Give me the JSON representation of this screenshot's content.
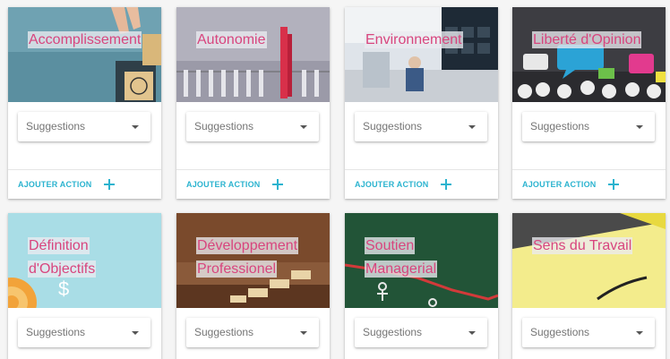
{
  "common": {
    "select_placeholder": "Suggestions",
    "action_label": "AJOUTER ACTION"
  },
  "cards": [
    {
      "title": "Accomplissement"
    },
    {
      "title": "Autonomie"
    },
    {
      "title": "Environnement"
    },
    {
      "title": "Liberté d'Opinion"
    },
    {
      "title_lines": [
        "Définition",
        "d'Objectifs"
      ]
    },
    {
      "title_lines": [
        "Développement",
        "Professionel"
      ]
    },
    {
      "title_lines": [
        "Soutien",
        "Managerial"
      ]
    },
    {
      "title": "Sens du Travail"
    }
  ],
  "colors": {
    "accent": "#2bb3cf",
    "title": "#d8457e",
    "background": "#f5f5f5"
  },
  "image_icons": [
    "hand-blocks-image",
    "clothespin-image",
    "office-image",
    "speech-bubbles-image",
    "target-dollar-image",
    "wooden-blocks-image",
    "chalkboard-image",
    "sticky-note-image"
  ]
}
